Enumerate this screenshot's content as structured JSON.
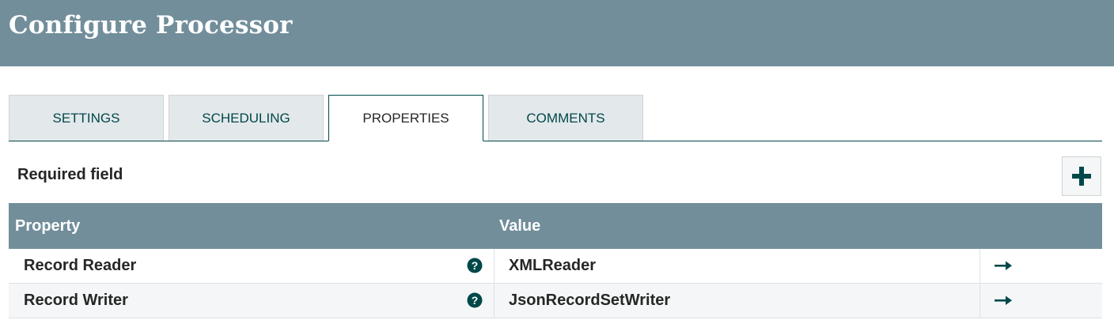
{
  "header": {
    "title": "Configure Processor"
  },
  "tabs": [
    {
      "label": "SETTINGS",
      "active": false
    },
    {
      "label": "SCHEDULING",
      "active": false
    },
    {
      "label": "PROPERTIES",
      "active": true
    },
    {
      "label": "COMMENTS",
      "active": false
    }
  ],
  "properties_panel": {
    "required_label": "Required field",
    "add_button_icon": "plus-icon"
  },
  "table": {
    "columns": [
      "Property",
      "Value"
    ],
    "rows": [
      {
        "property": "Record Reader",
        "value": "XMLReader",
        "help_icon": "question-circle-icon",
        "action_icon": "arrow-right-icon"
      },
      {
        "property": "Record Writer",
        "value": "JsonRecordSetWriter",
        "help_icon": "question-circle-icon",
        "action_icon": "arrow-right-icon"
      }
    ]
  },
  "colors": {
    "header_bg": "#728e9b",
    "accent": "#004849",
    "tab_bg": "#e3e8eb",
    "row_alt_bg": "#f4f6f7"
  }
}
